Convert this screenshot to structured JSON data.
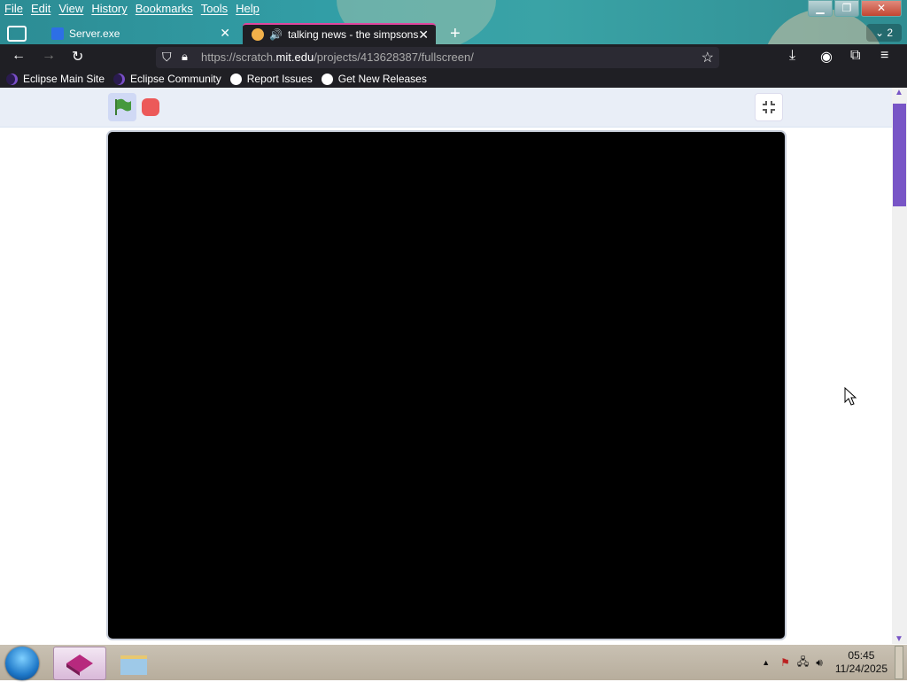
{
  "menubar": {
    "items": [
      "File",
      "Edit",
      "View",
      "History",
      "Bookmarks",
      "Tools",
      "Help"
    ]
  },
  "window_controls": {
    "minimize": "▁",
    "restore": "❐",
    "close": "✕"
  },
  "tabs": [
    {
      "title": "Server.exe",
      "icon": "dropbox-icon",
      "active": false
    },
    {
      "title": "talking news - the simpsons",
      "icon": "scratch-icon",
      "active": true,
      "audio": true
    }
  ],
  "tab_count": "2",
  "nav": {
    "url_host_prefix": "https://scratch.",
    "url_host": "mit.edu",
    "url_path": "/projects/413628387/fullscreen/"
  },
  "bookmarks": [
    {
      "label": "Eclipse Main Site",
      "icon": "eclipse-icon"
    },
    {
      "label": "Eclipse Community",
      "icon": "eclipse-icon"
    },
    {
      "label": "Report Issues",
      "icon": "github-icon"
    },
    {
      "label": "Get New Releases",
      "icon": "github-icon"
    }
  ],
  "colors": {
    "accent_tab": "#e0479e",
    "scrollbar_thumb": "#7855c6",
    "stop": "#ec5959",
    "flag": "#45993d"
  },
  "taskbar": {
    "time": "05:45",
    "date": "11/24/2025"
  }
}
